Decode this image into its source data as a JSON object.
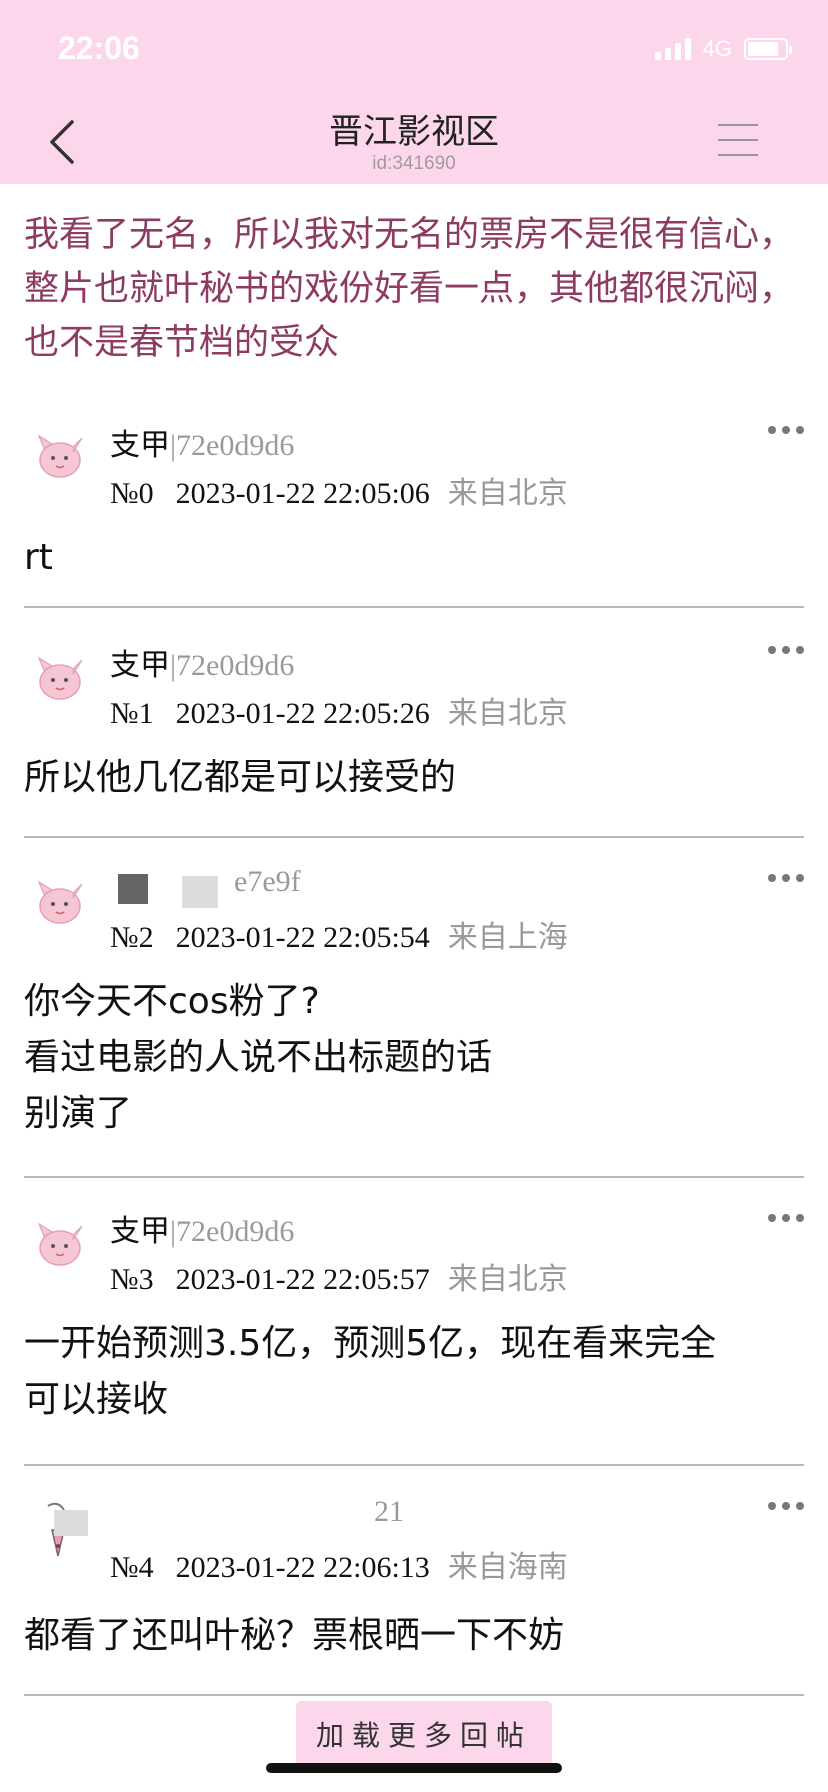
{
  "status_bar": {
    "time": "22:06",
    "network": "4G"
  },
  "nav": {
    "title": "晋江影视区",
    "subtitle": "id:341690"
  },
  "topic": {
    "text": "我看了无名，所以我对无名的票房不是很有信心，整片也就叶秘书的戏份好看一点，其他都很沉闷，也不是春节档的受众"
  },
  "posts": [
    {
      "author": "支甲",
      "sep": "|",
      "pid": "72e0d9d6",
      "floor": "№0",
      "time": "2023-01-22 22:05:06",
      "location": "来自北京",
      "lines": [
        "rt"
      ]
    },
    {
      "author": "支甲",
      "sep": "|",
      "pid": "72e0d9d6",
      "floor": "№1",
      "time": "2023-01-22 22:05:26",
      "location": "来自北京",
      "lines": [
        "所以他几亿都是可以接受的"
      ]
    },
    {
      "author": "",
      "sep": "",
      "pid": "e7e9f",
      "floor": "№2",
      "time": "2023-01-22 22:05:54",
      "location": "来自上海",
      "lines": [
        "你今天不cos粉了?",
        "看过电影的人说不出标题的话",
        "别演了"
      ]
    },
    {
      "author": "支甲",
      "sep": "|",
      "pid": "72e0d9d6",
      "floor": "№3",
      "time": "2023-01-22 22:05:57",
      "location": "来自北京",
      "lines": [
        "一开始预测3.5亿，预测5亿，现在看来完全",
        "可以接收"
      ]
    },
    {
      "author": "",
      "sep": "",
      "pid": "21",
      "floor": "№4",
      "time": "2023-01-22 22:06:13",
      "location": "来自海南",
      "lines": [
        "都看了还叫叶秘？票根晒一下不妨"
      ]
    }
  ],
  "footer": {
    "load_more": "加载更多回帖"
  },
  "icons": {
    "back": "back-chevron-icon",
    "menu": "hamburger-menu-icon",
    "more": "more-dots-icon",
    "avatar": "pink-creature-avatar"
  },
  "colors": {
    "header_bg": "#fcd6ea",
    "topic_text": "#8e3b63",
    "muted": "#999999"
  }
}
